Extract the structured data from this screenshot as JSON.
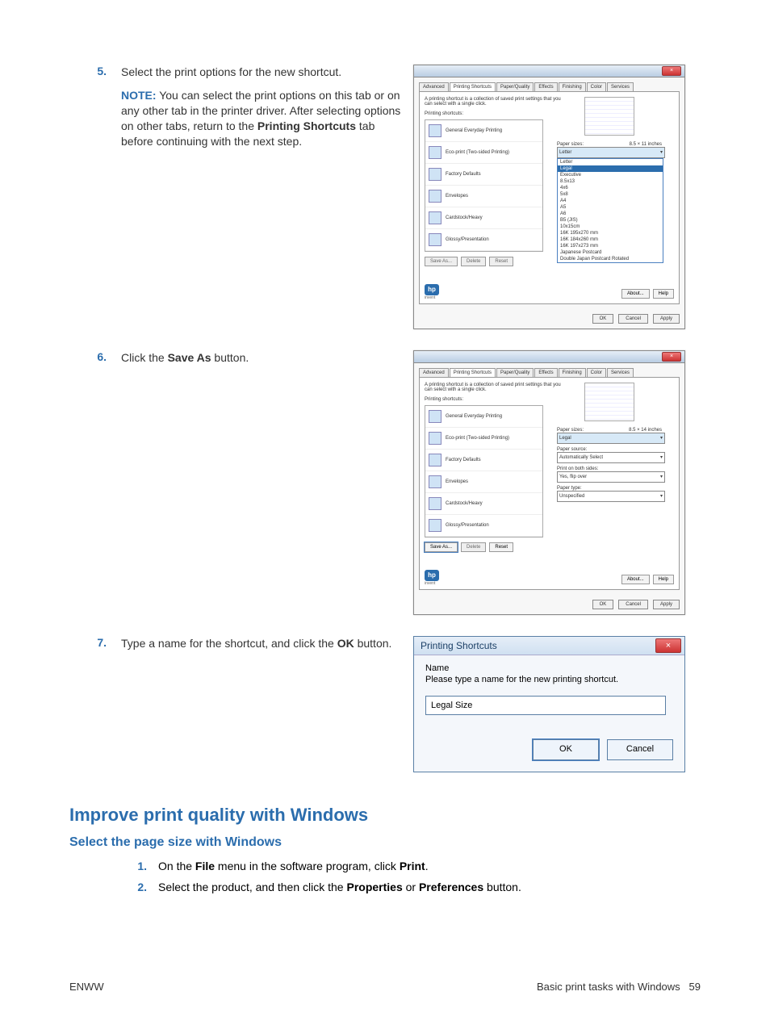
{
  "steps": {
    "s5": {
      "num": "5.",
      "text": "Select the print options for the new shortcut.",
      "note_label": "NOTE:",
      "note_body1": "You can select the print options on this tab or on any other tab in the printer driver. After selecting options on other tabs, return to the ",
      "note_bold": "Printing Shortcuts",
      "note_body2": " tab before continuing with the next step."
    },
    "s6": {
      "num": "6.",
      "text_a": "Click the ",
      "text_bold": "Save As",
      "text_b": " button."
    },
    "s7": {
      "num": "7.",
      "text_a": "Type a name for the shortcut, and click the ",
      "text_bold": "OK",
      "text_b": " button."
    }
  },
  "driver": {
    "tabs": [
      "Advanced",
      "Printing Shortcuts",
      "Paper/Quality",
      "Effects",
      "Finishing",
      "Color",
      "Services"
    ],
    "desc": "A printing shortcut is a collection of saved print settings that you can select with a single click.",
    "list_label": "Printing shortcuts:",
    "shortcuts": [
      "General Everyday Printing",
      "Eco-print (Two-sided Printing)",
      "Factory Defaults",
      "Envelopes",
      "Cardstock/Heavy",
      "Glossy/Presentation"
    ],
    "btns": {
      "save": "Save As...",
      "delete": "Delete",
      "reset": "Reset"
    },
    "about": "About...",
    "help": "Help",
    "ok": "OK",
    "cancel": "Cancel",
    "apply": "Apply",
    "invent": "invent",
    "panel1": {
      "paper_sizes": "Paper sizes:",
      "dim": "8.5 × 11 inches",
      "sel": "Letter",
      "open": [
        "Letter",
        "Legal",
        "Executive",
        "8.5x13",
        "4x6",
        "5x8",
        "A4",
        "A5",
        "A6",
        "B5 (JIS)",
        "10x15cm",
        "16K 195x270 mm",
        "16K 184x260 mm",
        "16K 197x273 mm",
        "Japanese Postcard",
        "Double Japan Postcard Rotated"
      ]
    },
    "panel2": {
      "paper_sizes": "Paper sizes:",
      "dim": "8.5 × 14 inches",
      "sel": "Legal",
      "paper_source": "Paper source:",
      "src": "Automatically Select",
      "both": "Print on both sides:",
      "both_v": "Yes, flip over",
      "ptype": "Paper type:",
      "ptype_v": "Unspecified"
    }
  },
  "savedlg": {
    "title": "Printing Shortcuts",
    "name_label": "Name",
    "hint": "Please type a name for the new printing shortcut.",
    "value": "Legal Size",
    "ok": "OK",
    "cancel": "Cancel"
  },
  "section": {
    "h2": "Improve print quality with Windows",
    "h3": "Select the page size with Windows",
    "s1": {
      "n": "1.",
      "a": "On the ",
      "b1": "File",
      "b": " menu in the software program, click ",
      "b2": "Print",
      "c": "."
    },
    "s2": {
      "n": "2.",
      "a": "Select the product, and then click the ",
      "b1": "Properties",
      "b": " or ",
      "b2": "Preferences",
      "c": " button."
    }
  },
  "footer": {
    "left": "ENWW",
    "right_a": "Basic print tasks with Windows",
    "page": "59"
  }
}
